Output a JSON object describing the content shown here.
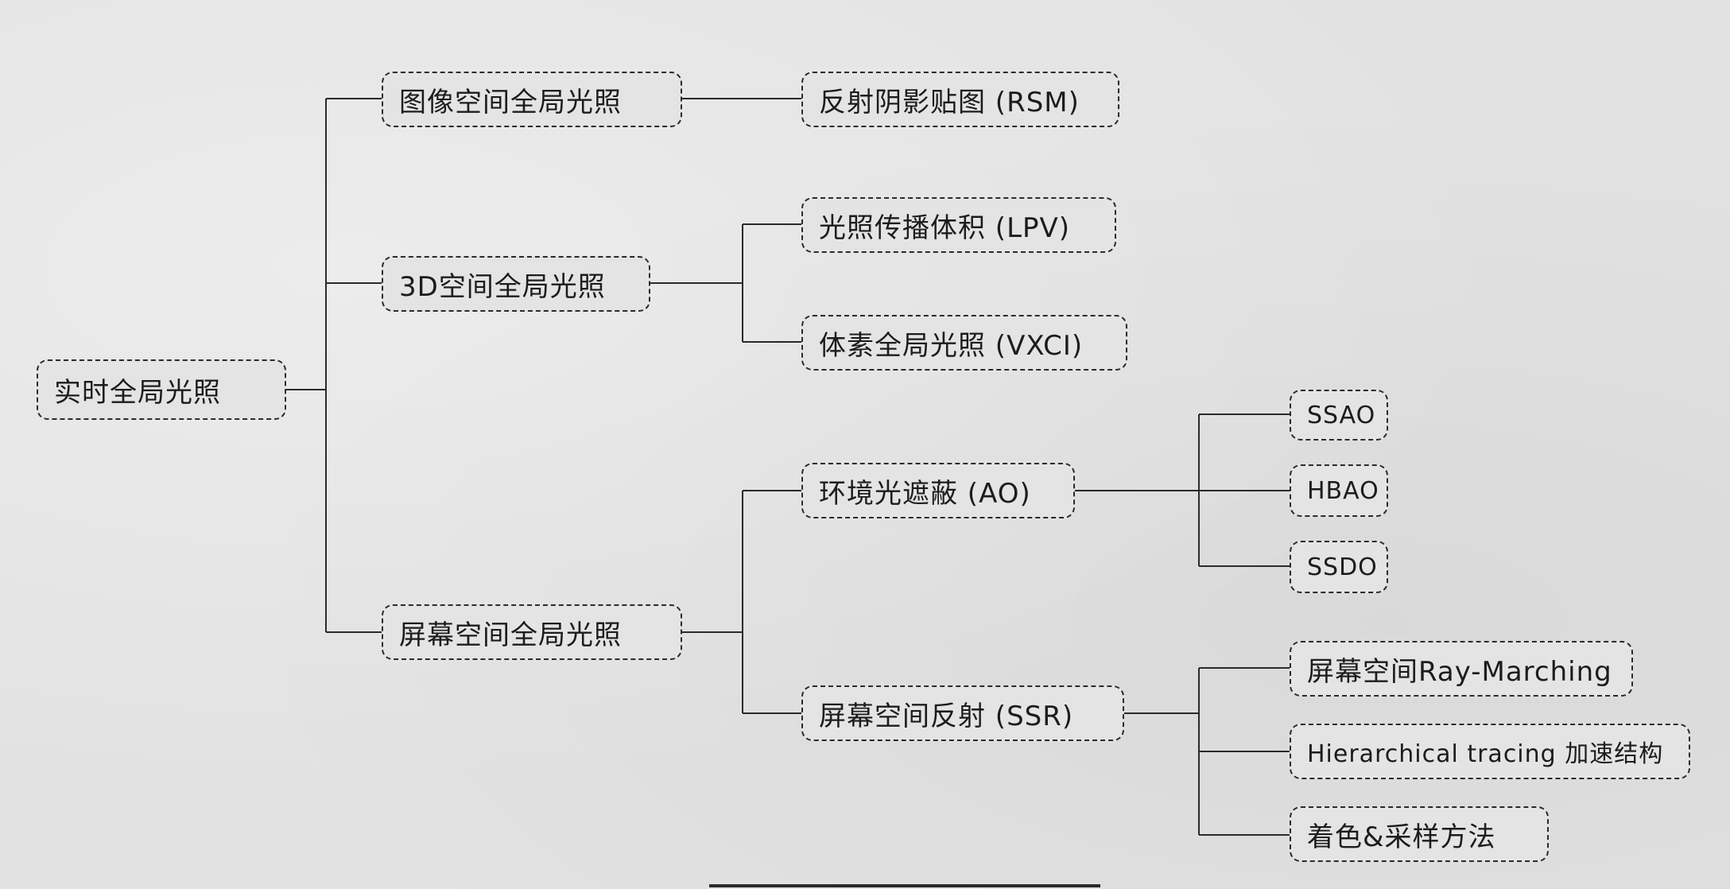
{
  "diagram": {
    "root": {
      "label": "实时全局光照"
    },
    "branches": [
      {
        "label": "图像空间全局光照",
        "children": [
          {
            "label": "反射阴影贴图 (RSM)"
          }
        ]
      },
      {
        "label": "3D空间全局光照",
        "children": [
          {
            "label": "光照传播体积 (LPV)"
          },
          {
            "label": "体素全局光照 (VXCI)"
          }
        ]
      },
      {
        "label": "屏幕空间全局光照",
        "children": [
          {
            "label": "环境光遮蔽 (AO)",
            "children": [
              {
                "label": "SSAO"
              },
              {
                "label": "HBAO"
              },
              {
                "label": "SSDO"
              }
            ]
          },
          {
            "label": "屏幕空间反射 (SSR)",
            "children": [
              {
                "label": "屏幕空间Ray-Marching"
              },
              {
                "label": "Hierarchical tracing 加速结构"
              },
              {
                "label": "着色&采样方法"
              }
            ]
          }
        ]
      }
    ]
  },
  "colors": {
    "background": "#e4e4e4",
    "line": "#2a2a2a",
    "text": "#1c1c1c"
  }
}
